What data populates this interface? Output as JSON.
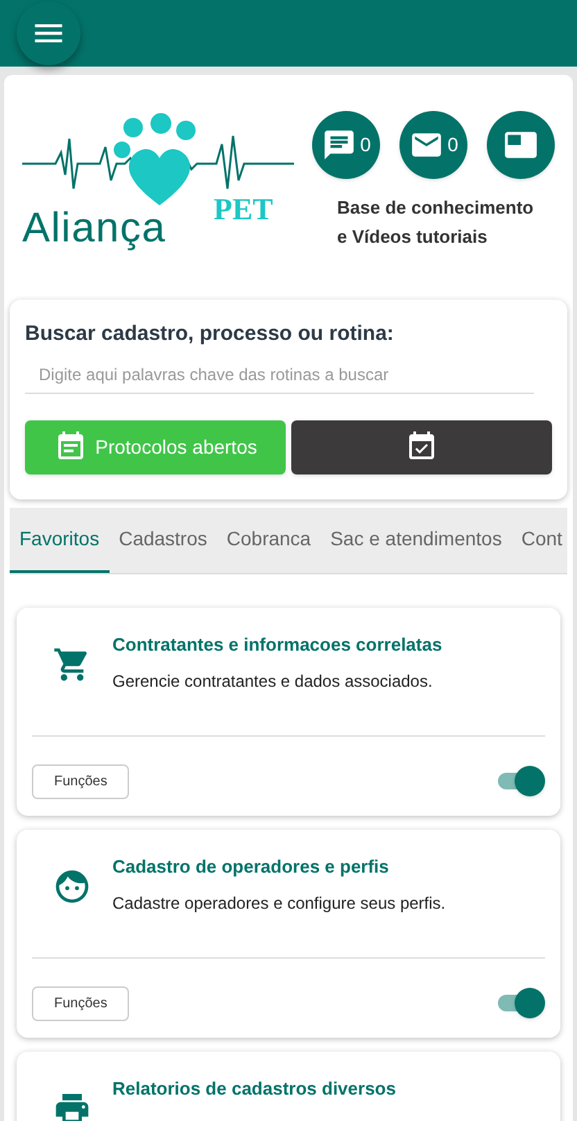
{
  "logo": {
    "name": "Aliança",
    "suffix": "PET"
  },
  "actions": [
    {
      "kind": "chat",
      "count": "0"
    },
    {
      "kind": "mail",
      "count": "0"
    },
    {
      "kind": "panel"
    }
  ],
  "knowledge_label": "Base de conhecimento\ne Vídeos tutoriais",
  "search": {
    "title": "Buscar cadastro, processo ou rotina:",
    "placeholder": "Digite aqui palavras chave das rotinas a buscar",
    "buttons": [
      {
        "kind": "protocols",
        "label": "Protocolos abertos"
      },
      {
        "kind": "calendar"
      }
    ]
  },
  "tabs": [
    {
      "label": "Favoritos",
      "selected": true
    },
    {
      "label": "Cadastros",
      "selected": false
    },
    {
      "label": "Cobranca",
      "selected": false
    },
    {
      "label": "Sac e atendimentos",
      "selected": false
    },
    {
      "label": "Cont",
      "selected": false
    }
  ],
  "cards": [
    {
      "kind": "cart",
      "title": "Contratantes e informacoes correlatas",
      "description": "Gerencie contratantes e dados associados.",
      "button": "Funções",
      "on": true
    },
    {
      "kind": "face",
      "title": "Cadastro de operadores e perfis",
      "description": "Cadastre operadores e configure seus perfis.",
      "button": "Funções",
      "on": true
    },
    {
      "kind": "printer",
      "title": "Relatorios de cadastros diversos"
    }
  ]
}
